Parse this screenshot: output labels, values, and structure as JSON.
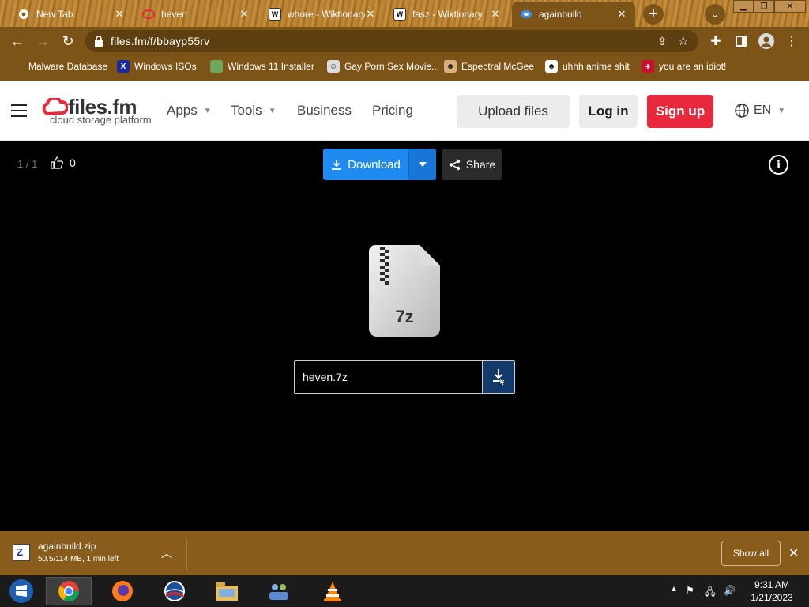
{
  "browser": {
    "tabs": [
      {
        "label": "New Tab",
        "icon": "chrome-icon"
      },
      {
        "label": "heven",
        "icon": "files-fm-icon"
      },
      {
        "label": "whore - Wiktionary",
        "icon": "wiktionary-icon"
      },
      {
        "label": "fasz - Wiktionary",
        "icon": "wiktionary-icon"
      },
      {
        "label": "againbuild",
        "icon": "files-fm-icon"
      }
    ],
    "new_tab": "+",
    "url": "files.fm/f/bbayp55rv",
    "bookmarks": [
      {
        "label": "Malware Database"
      },
      {
        "label": "Windows ISOs"
      },
      {
        "label": "Windows 11 Installer"
      },
      {
        "label": "Gay Porn Sex Movie..."
      },
      {
        "label": "Espectral McGee"
      },
      {
        "label": "uhhh anime shit"
      },
      {
        "label": "you are an idiot!"
      }
    ]
  },
  "site": {
    "logo_name": "files.fm",
    "logo_tagline": "cloud storage platform",
    "nav": {
      "apps": "Apps",
      "tools": "Tools",
      "business": "Business",
      "pricing": "Pricing"
    },
    "upload": "Upload files",
    "login": "Log in",
    "signup": "Sign up",
    "language": "EN",
    "colors": {
      "primary": "#1f8bf0",
      "signup": "#e8283c"
    }
  },
  "viewer": {
    "page_count": "1 / 1",
    "likes": "0",
    "download": "Download",
    "share": "Share",
    "file_type": "7z",
    "file_name": "heven.7z"
  },
  "download_bar": {
    "file": "againbuild.zip",
    "status": "50.5/114 MB, 1 min left",
    "show_all": "Show all"
  },
  "taskbar": {
    "time": "9:31 AM",
    "date": "1/21/2023"
  }
}
